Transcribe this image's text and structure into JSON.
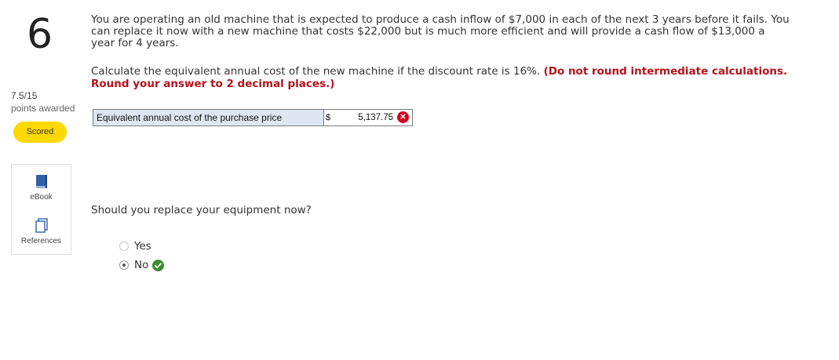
{
  "question_number": "6",
  "score": {
    "value": "7.5/15",
    "awarded_label": "points awarded",
    "status": "Scored"
  },
  "tools": {
    "ebook_label": "eBook",
    "references_label": "References"
  },
  "question_text": "You are operating an old machine that is expected to produce a cash inflow of $7,000 in each of the next 3 years before it fails. You can replace it now with a new machine that costs $22,000 but is much more efficient and will provide a cash flow of $13,000 a year for 4 years.",
  "calc_text": "Calculate the equivalent annual cost of the new machine if the discount rate is 16%.",
  "instruction_text": "(Do not round intermediate calculations. Round your answer to 2 decimal places.)",
  "answer_row": {
    "label": "Equivalent annual cost of the purchase price",
    "currency": "$",
    "value": "5,137.75"
  },
  "replace_question": "Should you replace your equipment now?",
  "options": [
    {
      "label": "Yes",
      "selected": false
    },
    {
      "label": "No",
      "selected": true
    }
  ],
  "colors": {
    "instruction_red": "#b5121b",
    "scored_yellow": "#ffd800",
    "incorrect_red": "#d0021b",
    "correct_green": "#3c8d2f",
    "label_cell_blue": "#dfe6f2"
  },
  "icons": {
    "incorrect": "x-circle-icon",
    "correct": "check-circle-icon",
    "ebook": "book-icon",
    "references": "documents-icon"
  }
}
